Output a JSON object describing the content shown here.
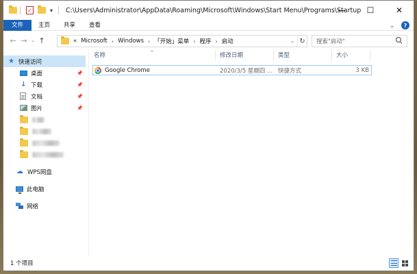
{
  "window": {
    "title_path": "C:\\Users\\Administrator\\AppData\\Roaming\\Microsoft\\Windows\\Start Menu\\Programs\\Startup",
    "controls": {
      "minimize": "—",
      "maximize": "☐",
      "close": "✕"
    }
  },
  "ribbon": {
    "tabs": [
      "文件",
      "主页",
      "共享",
      "查看"
    ]
  },
  "address": {
    "overflow": "«",
    "crumbs": [
      "Microsoft",
      "Windows",
      "「开始」菜单",
      "程序",
      "启动"
    ]
  },
  "search": {
    "placeholder": "搜索\"启动\""
  },
  "sidebar": {
    "quick_access": "快速访问",
    "pinned": [
      "桌面",
      "下载",
      "文档",
      "图片"
    ],
    "wps": "WPS网盘",
    "this_pc": "此电脑",
    "network": "网络"
  },
  "columns": {
    "name": "名称",
    "date": "修改日期",
    "type": "类型",
    "size": "大小"
  },
  "files": [
    {
      "name": "Google Chrome",
      "date": "2020/3/5 星期四 ...",
      "type": "快捷方式",
      "size": "3 KB"
    }
  ],
  "status": {
    "count": "1 个项目"
  },
  "colors": {
    "accent": "#1a63b8",
    "selection": "#cce4f7",
    "row_border": "#99c9ef"
  }
}
